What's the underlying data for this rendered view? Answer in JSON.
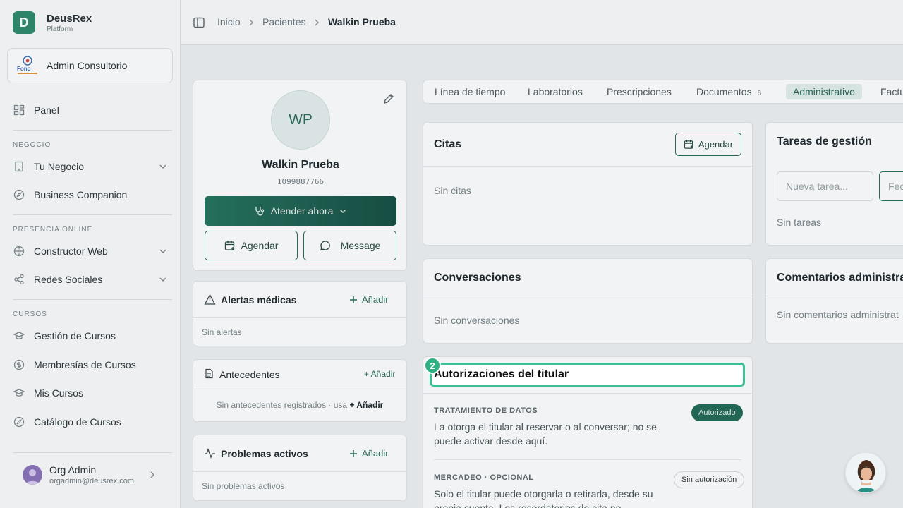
{
  "brand": {
    "name": "DeusRex",
    "sub": "Platform",
    "logo_letter": "D"
  },
  "org": {
    "name": "Admin Consultorio",
    "logo_text": "Fono"
  },
  "nav": {
    "panel": "Panel",
    "section_negocio": "NEGOCIO",
    "tu_negocio": "Tu Negocio",
    "business_companion": "Business Companion",
    "section_presencia": "PRESENCIA ONLINE",
    "constructor_web": "Constructor Web",
    "redes_sociales": "Redes Sociales",
    "section_cursos": "CURSOS",
    "gestion_cursos": "Gestión de Cursos",
    "membresias": "Membresías de Cursos",
    "mis_cursos": "Mis Cursos",
    "catalogo": "Catálogo de Cursos"
  },
  "user": {
    "name": "Org Admin",
    "email": "orgadmin@deusrex.com"
  },
  "breadcrumb": {
    "home": "Inicio",
    "patients": "Pacientes",
    "current": "Walkin Prueba"
  },
  "profile": {
    "initials": "WP",
    "name": "Walkin Prueba",
    "id": "1099887766",
    "attend_label": "Atender ahora",
    "schedule_label": "Agendar",
    "message_label": "Message"
  },
  "alerts": {
    "title": "Alertas médicas",
    "add": "Añadir",
    "empty": "Sin alertas"
  },
  "history": {
    "title": "Antecedentes",
    "add": "+ Añadir",
    "empty": "Sin antecedentes registrados · usa ",
    "empty_link": "+ Añadir"
  },
  "problems": {
    "title": "Problemas activos",
    "add": "Añadir",
    "empty": "Sin problemas activos"
  },
  "tabs": [
    {
      "label": "Línea de tiempo"
    },
    {
      "label": "Laboratorios"
    },
    {
      "label": "Prescripciones"
    },
    {
      "label": "Documentos",
      "count": "6"
    },
    {
      "label": "Administrativo"
    },
    {
      "label": "Factu"
    }
  ],
  "citas": {
    "title": "Citas",
    "button": "Agendar",
    "empty": "Sin citas"
  },
  "conversaciones": {
    "title": "Conversaciones",
    "empty": "Sin conversaciones"
  },
  "autorizaciones": {
    "title": "Autorizaciones del titular",
    "marker": "2",
    "items": [
      {
        "label": "TRATAMIENTO DE DATOS",
        "badge": "Autorizado",
        "text_line1": "La otorga el titular al reservar o al conversar; no se",
        "text_line2": "puede activar desde aquí."
      },
      {
        "label": "MERCADEO · OPCIONAL",
        "badge": "Sin autorización",
        "text_line1": "Solo el titular puede otorgarla o retirarla, desde su",
        "text_line2": "propia cuenta. Los recordatorios de cita no"
      }
    ]
  },
  "tareas": {
    "title": "Tareas de gestión",
    "new_placeholder": "Nueva tarea...",
    "date_placeholder": "Fec",
    "empty": "Sin tareas"
  },
  "comentarios": {
    "title": "Comentarios administra",
    "empty": "Sin comentarios administrat"
  },
  "colors": {
    "accent": "#2b6b5a",
    "brand": "#2f8a6b",
    "highlight": "#3bbf94",
    "primary_button": "#1f6352"
  }
}
